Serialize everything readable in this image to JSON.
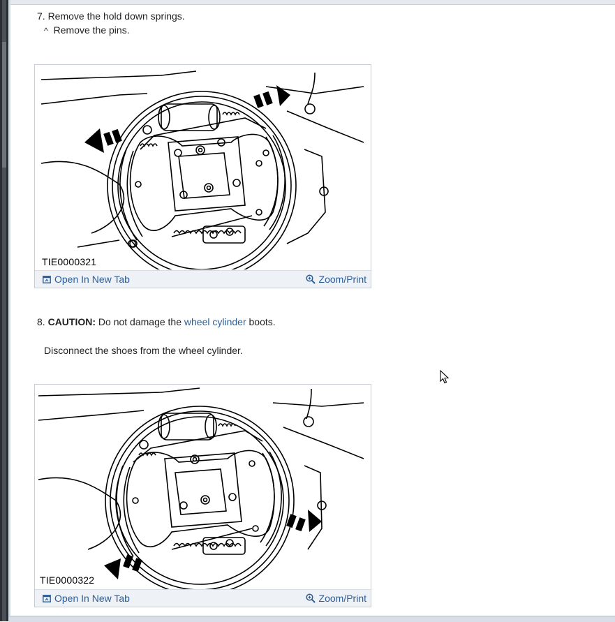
{
  "steps": {
    "step7": {
      "text": "7. Remove the hold down springs.",
      "sub_marker": "^",
      "sub_text": "Remove the pins."
    },
    "step8": {
      "number": "8.",
      "caution_label": "CAUTION:",
      "text_before": "Do not damage the",
      "link": "wheel cylinder",
      "text_after": "boots.",
      "sub_text": "Disconnect the shoes from the wheel cylinder."
    }
  },
  "figures": [
    {
      "id": "TIE0000321",
      "open_label": "Open In New Tab",
      "zoom_label": "Zoom/Print"
    },
    {
      "id": "TIE0000322",
      "open_label": "Open In New Tab",
      "zoom_label": "Zoom/Print"
    }
  ],
  "icons": {
    "open_tab": "open-new-tab-icon",
    "zoom": "magnifier-plus-icon",
    "cursor": "mouse-pointer-icon"
  },
  "colors": {
    "link": "#2a5e9a",
    "toolbar_bg": "#eef1f5",
    "frame": "#2b2f35"
  }
}
